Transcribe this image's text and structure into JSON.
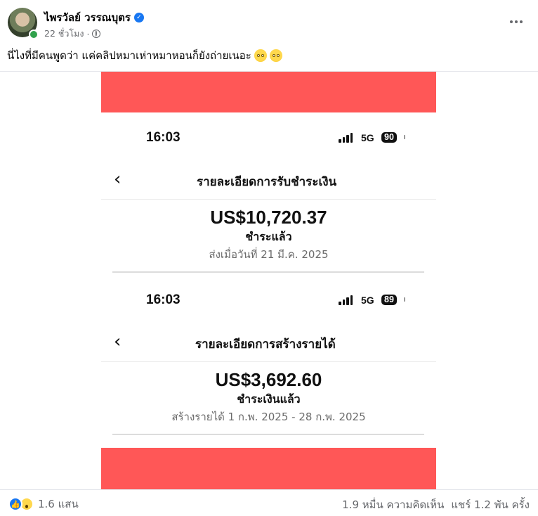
{
  "post": {
    "author": "ไพรวัลย์ วรรณบุตร",
    "time": "22 ชั่วโมง",
    "caption": "นี่ไงที่มีคนพูดว่า แค่คลิปหมาเห่าหมาหอนก็ยังถ่ายเนอะ",
    "caption_emoji_name": "face-with-rolling-eyes"
  },
  "screenshot": {
    "redbar_color": "#ff5757",
    "panels": [
      {
        "time": "16:03",
        "network": "5G",
        "battery": "90",
        "title": "รายละเอียดการรับชำระเงิน",
        "amount": "US$10,720.37",
        "status": "ชำระแล้ว",
        "detail": "ส่งเมื่อวันที่ 21 มี.ค. 2025"
      },
      {
        "time": "16:03",
        "network": "5G",
        "battery": "89",
        "title": "รายละเอียดการสร้างรายได้",
        "amount": "US$3,692.60",
        "status": "ชำระเงินแล้ว",
        "detail": "สร้างรายได้ 1 ก.พ. 2025 - 28 ก.พ. 2025"
      }
    ]
  },
  "footer": {
    "reaction_count": "1.6 แสน",
    "comments": "1.9 หมื่น ความคิดเห็น",
    "shares": "แชร์ 1.2 พัน ครั้ง"
  }
}
